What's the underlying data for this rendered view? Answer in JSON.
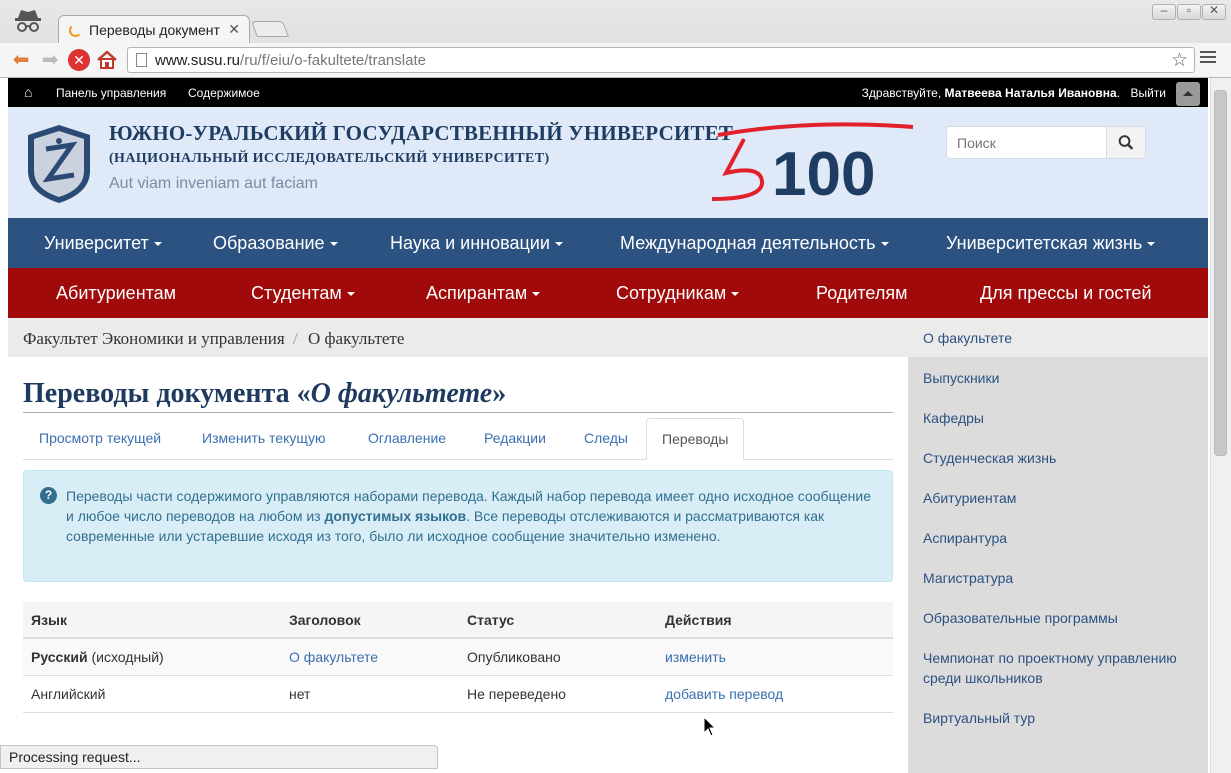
{
  "browser": {
    "tab_title": "Переводы документ",
    "url_host": "www.susu.ru",
    "url_path": "/ru/f/eiu/o-fakultete/translate",
    "status_text": "Processing request..."
  },
  "adminbar": {
    "panel": "Панель управления",
    "content": "Содержимое",
    "greeting": "Здравствуйте,",
    "user": "Матвеева Наталья Ивановна",
    "greeting_end": ".",
    "logout": "Выйти"
  },
  "header": {
    "name": "ЮЖНО-УРАЛЬСКИЙ ГОСУДАРСТВЕННЫЙ УНИВЕРСИТЕТ",
    "subtitle": "(НАЦИОНАЛЬНЫЙ ИССЛЕДОВАТЕЛЬСКИЙ УНИВЕРСИТЕТ)",
    "motto": "Aut viam inveniam aut faciam",
    "logo_text": "100",
    "search_placeholder": "Поиск"
  },
  "mainnav": [
    "Университет",
    "Образование",
    "Наука и инновации",
    "Международная деятельность",
    "Университетская жизнь"
  ],
  "subnav": [
    "Абитуриентам",
    "Студентам",
    "Аспирантам",
    "Сотрудникам",
    "Родителям",
    "Для прессы и гостей"
  ],
  "breadcrumb": {
    "parent": "Факультет Экономики и управления",
    "sep": "/",
    "current": "О факультете"
  },
  "page": {
    "title_prefix": "Переводы документа «",
    "title_doc": "О факультете",
    "title_suffix": "»"
  },
  "tabs": [
    "Просмотр текущей",
    "Изменить текущую",
    "Оглавление",
    "Редакции",
    "Следы",
    "Переводы"
  ],
  "alert": {
    "part1": "Переводы части содержимого управляются наборами перевода. Каждый набор перевода имеет одно исходное сообщение и любое число переводов на любом из ",
    "link": "допустимых языков",
    "part2": ". Все переводы отслеживаются и рассматриваются как современные или устаревшие исходя из того, было ли исходное сообщение значительно изменено."
  },
  "table": {
    "headers": [
      "Язык",
      "Заголовок",
      "Статус",
      "Действия"
    ],
    "rows": [
      {
        "lang": "Русский",
        "lang_note": " (исходный)",
        "title": "О факультете",
        "status": "Опубликовано",
        "action": "изменить"
      },
      {
        "lang": "Английский",
        "lang_note": "",
        "title": "нет",
        "status": "Не переведено",
        "action": "добавить перевод"
      }
    ]
  },
  "sidebar": [
    "О факультете",
    "Выпускники",
    "Кафедры",
    "Студенческая жизнь",
    "Абитуриентам",
    "Аспирантура",
    "Магистратура",
    "Образовательные программы",
    "Чемпионат по проектному управлению среди школьников",
    "Виртуальный тур"
  ],
  "colors": {
    "mainnav_bg": "#2c5281",
    "subnav_bg": "#a10a0a",
    "header_bg": "#dfe9f7",
    "link": "#3a6fb0",
    "alert_bg": "#d9edf7"
  }
}
